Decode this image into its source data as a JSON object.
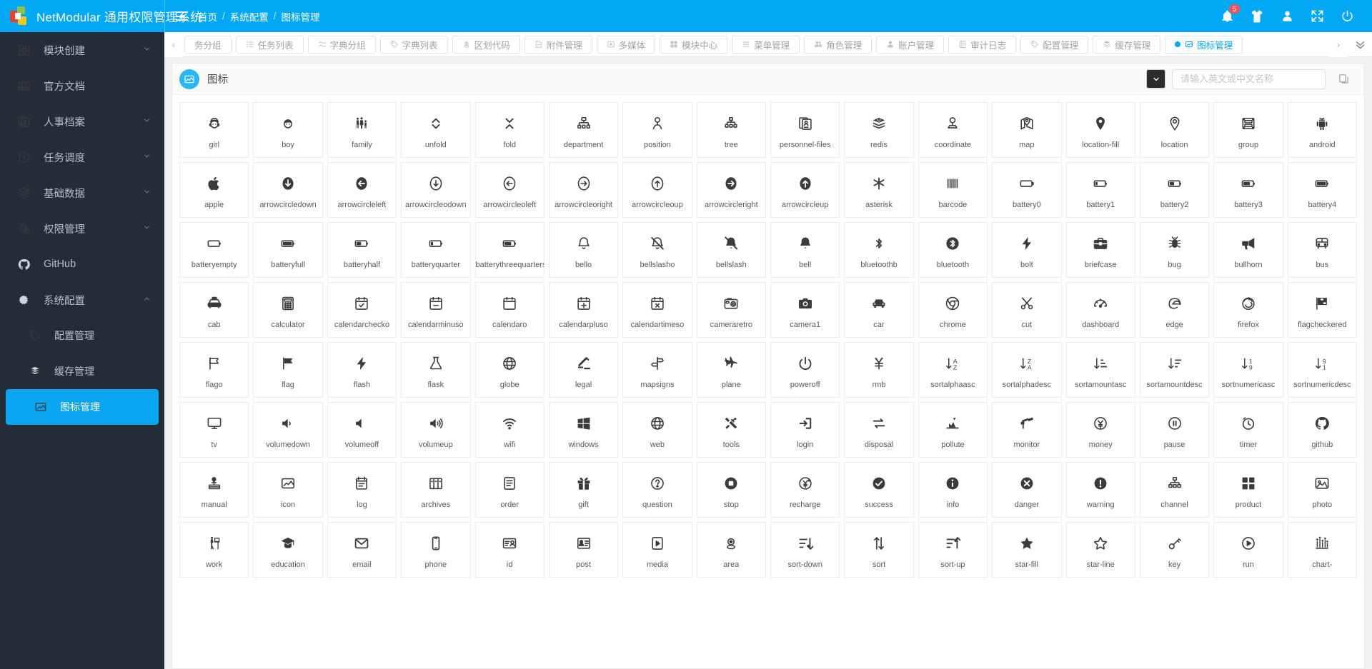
{
  "header": {
    "brand_title": "NetModular 通用权限管理系统",
    "breadcrumb": [
      "首页",
      "系统配置",
      "图标管理"
    ],
    "separator": "/",
    "notification_count": "5",
    "tools": [
      "bell-icon",
      "theme-shirt-icon",
      "user-icon",
      "fullscreen-icon",
      "power-icon"
    ]
  },
  "sidebar": {
    "items": [
      {
        "label": "模块创建",
        "icon": "module-create-icon",
        "arrow": "chevron-down",
        "active": false,
        "sub": false
      },
      {
        "label": "官方文档",
        "icon": "docs-icon",
        "arrow": "",
        "active": false,
        "sub": false
      },
      {
        "label": "人事档案",
        "icon": "personnel-files-icon",
        "arrow": "chevron-down",
        "active": false,
        "sub": false
      },
      {
        "label": "任务调度",
        "icon": "task-schedule-icon",
        "arrow": "chevron-down",
        "active": false,
        "sub": false
      },
      {
        "label": "基础数据",
        "icon": "layers-icon",
        "arrow": "chevron-down",
        "active": false,
        "sub": false
      },
      {
        "label": "权限管理",
        "icon": "permission-gear-icon",
        "arrow": "chevron-down",
        "active": false,
        "sub": false
      },
      {
        "label": "GitHub",
        "icon": "github-icon",
        "arrow": "",
        "active": false,
        "sub": false
      },
      {
        "label": "系统配置",
        "icon": "system-config-gear-icon",
        "arrow": "chevron-up",
        "active": false,
        "sub": false
      },
      {
        "label": "配置管理",
        "icon": "tag-icon",
        "arrow": "",
        "active": false,
        "sub": true
      },
      {
        "label": "缓存管理",
        "icon": "cache-stack-icon",
        "arrow": "",
        "active": false,
        "sub": true
      },
      {
        "label": "图标管理",
        "icon": "image-icon",
        "arrow": "",
        "active": true,
        "sub": true
      }
    ]
  },
  "tabstrip": {
    "prev_label": "‹",
    "next_label": "›",
    "more_label": "⌄",
    "tabs": [
      {
        "label": "务分组",
        "icon": "none",
        "active": false,
        "truncated": true
      },
      {
        "label": "任务列表",
        "icon": "list-icon",
        "active": false
      },
      {
        "label": "字典分组",
        "icon": "dict-group-icon",
        "active": false
      },
      {
        "label": "字典列表",
        "icon": "tag-icon",
        "active": false
      },
      {
        "label": "区划代码",
        "icon": "region-icon",
        "active": false
      },
      {
        "label": "附件管理",
        "icon": "file-icon",
        "active": false
      },
      {
        "label": "多媒体",
        "icon": "media-icon",
        "active": false
      },
      {
        "label": "模块中心",
        "icon": "module-icon",
        "active": false
      },
      {
        "label": "菜单管理",
        "icon": "menu-icon",
        "active": false
      },
      {
        "label": "角色管理",
        "icon": "role-icon",
        "active": false
      },
      {
        "label": "账户管理",
        "icon": "account-icon",
        "active": false
      },
      {
        "label": "审计日志",
        "icon": "audit-icon",
        "active": false
      },
      {
        "label": "配置管理",
        "icon": "tag-icon",
        "active": false
      },
      {
        "label": "缓存管理",
        "icon": "cache-stack-icon",
        "active": false
      },
      {
        "label": "图标管理",
        "icon": "image-icon",
        "active": true
      }
    ]
  },
  "card": {
    "title": "图标",
    "title_icon": "image-icon",
    "select_button_icon": "chevron-down-icon",
    "search_placeholder": "请输入英文或中文名称",
    "search_value": "",
    "copy_button_icon": "copy-icon"
  },
  "icons": [
    "girl",
    "boy",
    "family",
    "unfold",
    "fold",
    "department",
    "position",
    "tree",
    "personnel-files",
    "redis",
    "coordinate",
    "map",
    "location-fill",
    "location",
    "group",
    "android",
    "apple",
    "arrowcircledown",
    "arrowcircleleft",
    "arrowcircleodown",
    "arrowcircleoleft",
    "arrowcircleoright",
    "arrowcircleoup",
    "arrowcircleright",
    "arrowcircleup",
    "asterisk",
    "barcode",
    "battery0",
    "battery1",
    "battery2",
    "battery3",
    "battery4",
    "batteryempty",
    "batteryfull",
    "batteryhalf",
    "batteryquarter",
    "batterythreequarters",
    "bello",
    "bellslasho",
    "bellslash",
    "bell",
    "bluetoothb",
    "bluetooth",
    "bolt",
    "briefcase",
    "bug",
    "bullhorn",
    "bus",
    "cab",
    "calculator",
    "calendarchecko",
    "calendarminuso",
    "calendaro",
    "calendarpluso",
    "calendartimeso",
    "cameraretro",
    "camera1",
    "car",
    "chrome",
    "cut",
    "dashboard",
    "edge",
    "firefox",
    "flagcheckered",
    "flago",
    "flag",
    "flash",
    "flask",
    "globe",
    "legal",
    "mapsigns",
    "plane",
    "poweroff",
    "rmb",
    "sortalphaasc",
    "sortalphadesc",
    "sortamountasc",
    "sortamountdesc",
    "sortnumericasc",
    "sortnumericdesc",
    "tv",
    "volumedown",
    "volumeoff",
    "volumeup",
    "wifi",
    "windows",
    "web",
    "tools",
    "login",
    "disposal",
    "pollute",
    "monitor",
    "money",
    "pause",
    "timer",
    "github",
    "manual",
    "icon",
    "log",
    "archives",
    "order",
    "gift",
    "question",
    "stop",
    "recharge",
    "success",
    "info",
    "danger",
    "warning",
    "channel",
    "product",
    "photo",
    "work",
    "education",
    "email",
    "phone",
    "id",
    "post",
    "media",
    "area",
    "sort-down",
    "sort",
    "sort-up",
    "star-fill",
    "star-line",
    "key",
    "run",
    "chart-"
  ],
  "colors": {
    "brand": "#03a9f4",
    "sidebar": "#242c38",
    "badge": "#ff4d4f",
    "page_bg": "#f0f2f5"
  }
}
